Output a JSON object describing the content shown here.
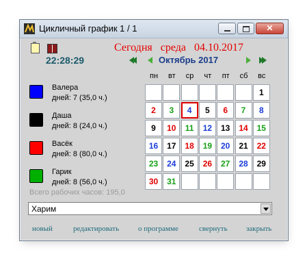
{
  "window": {
    "title": "Цикличный график 1 / 1",
    "close_glyph": "✕"
  },
  "header": {
    "today_label": "Сегодня   среда   04.10.2017",
    "clock": "22:28:29",
    "month": "Октябрь 2017"
  },
  "calendar": {
    "weekdays": [
      "пн",
      "вт",
      "ср",
      "чт",
      "пт",
      "сб",
      "вс"
    ],
    "days": [
      {
        "day": "1",
        "color": "#000000"
      },
      {
        "day": "2",
        "color": "#e00000"
      },
      {
        "day": "3",
        "color": "#16a016"
      },
      {
        "day": "4",
        "color": "#1a3cd8"
      },
      {
        "day": "5",
        "color": "#000000"
      },
      {
        "day": "6",
        "color": "#e00000"
      },
      {
        "day": "7",
        "color": "#16a016"
      },
      {
        "day": "8",
        "color": "#1a3cd8"
      },
      {
        "day": "9",
        "color": "#000000"
      },
      {
        "day": "10",
        "color": "#e00000"
      },
      {
        "day": "11",
        "color": "#16a016"
      },
      {
        "day": "12",
        "color": "#1a3cd8"
      },
      {
        "day": "13",
        "color": "#000000"
      },
      {
        "day": "14",
        "color": "#e00000"
      },
      {
        "day": "15",
        "color": "#16a016"
      },
      {
        "day": "16",
        "color": "#1a3cd8"
      },
      {
        "day": "17",
        "color": "#000000"
      },
      {
        "day": "18",
        "color": "#e00000"
      },
      {
        "day": "19",
        "color": "#16a016"
      },
      {
        "day": "20",
        "color": "#1a3cd8"
      },
      {
        "day": "21",
        "color": "#000000"
      },
      {
        "day": "22",
        "color": "#e00000"
      },
      {
        "day": "23",
        "color": "#16a016"
      },
      {
        "day": "24",
        "color": "#1a3cd8"
      },
      {
        "day": "25",
        "color": "#000000"
      },
      {
        "day": "26",
        "color": "#e00000"
      },
      {
        "day": "27",
        "color": "#16a016"
      },
      {
        "day": "28",
        "color": "#1a3cd8"
      },
      {
        "day": "29",
        "color": "#000000"
      },
      {
        "day": "30",
        "color": "#e00000"
      },
      {
        "day": "31",
        "color": "#16a016"
      }
    ],
    "selected_day": "4"
  },
  "people": [
    {
      "name": "Валера",
      "days": "дней: 7 (35,0 ч.)",
      "color": "#0000ff"
    },
    {
      "name": "Даша",
      "days": "дней: 8 (24,0 ч.)",
      "color": "#000000"
    },
    {
      "name": "Васёк",
      "days": "дней: 8 (80,0 ч.)",
      "color": "#ff0000"
    },
    {
      "name": "Гарик",
      "days": "дней: 8 (56,0 ч.)",
      "color": "#00b000"
    }
  ],
  "total_hours": "Всего рабочих часов:  195,0",
  "schedule_select": {
    "value": "Харим"
  },
  "footer": {
    "new": "новый",
    "edit": "редактировать",
    "about": "о программе",
    "minimize": "свернуть",
    "close": "закрыть"
  }
}
